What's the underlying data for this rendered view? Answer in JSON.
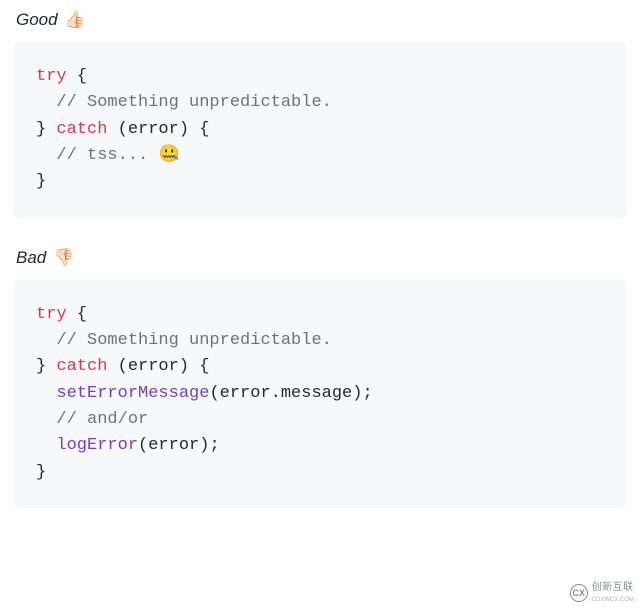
{
  "sections": {
    "good": {
      "label": "Good",
      "emoji": "👍🏻"
    },
    "bad": {
      "label": "Bad",
      "emoji": "👎🏻"
    }
  },
  "code": {
    "good": {
      "l1_try": "try",
      "l1_brace": " {",
      "l2_comment": "// Something unpredictable.",
      "l3_close": "} ",
      "l3_catch": "catch",
      "l3_args": " (error) {",
      "l4_comment_pre": "// tss... ",
      "l4_emoji": "🤐",
      "l5_close": "}"
    },
    "bad": {
      "l1_try": "try",
      "l1_brace": " {",
      "l2_comment": "// Something unpredictable.",
      "l3_close": "} ",
      "l3_catch": "catch",
      "l3_args": " (error) {",
      "l4_fn": "setErrorMessage",
      "l4_args": "(error.message);",
      "l5_comment": "// and/or",
      "l6_fn": "logError",
      "l6_args": "(error);",
      "l7_close": "}"
    }
  },
  "watermark": {
    "logo": "CX",
    "cn": "创新互联",
    "en": "CDXWCX.COM"
  }
}
